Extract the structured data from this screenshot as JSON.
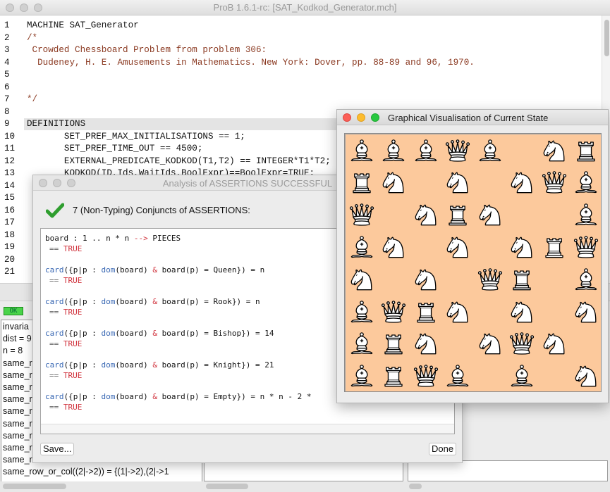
{
  "window": {
    "title": "ProB 1.6.1-rc: [SAT_Kodkod_Generator.mch]"
  },
  "editor": {
    "line_numbers": [
      "1",
      "2",
      "3",
      "4",
      "5",
      "6",
      "7",
      "8",
      "9",
      "10",
      "11",
      "12",
      "13",
      "14",
      "15",
      "16",
      "17",
      "18",
      "19",
      "20",
      "21"
    ],
    "lines": [
      {
        "text": "MACHINE SAT_Generator",
        "style": "code"
      },
      {
        "text": "/*",
        "style": "comment"
      },
      {
        "text": " Crowded Chessboard Problem from problem 306:",
        "style": "comment"
      },
      {
        "text": "  Dudeney, H. E. Amusements in Mathematics. New York: Dover, pp. 88-89 and 96, 1970.",
        "style": "comment"
      },
      {
        "text": "",
        "style": "comment"
      },
      {
        "text": "",
        "style": "comment"
      },
      {
        "text": "*/",
        "style": "comment"
      },
      {
        "text": "",
        "style": "code"
      },
      {
        "text": "DEFINITIONS",
        "style": "code",
        "highlight": true
      },
      {
        "text": "       SET_PREF_MAX_INITIALISATIONS == 1;",
        "style": "code"
      },
      {
        "text": "       SET_PREF_TIME_OUT == 4500;",
        "style": "code"
      },
      {
        "text": "       EXTERNAL_PREDICATE_KODKOD(T1,T2) == INTEGER*T1*T2;",
        "style": "code"
      },
      {
        "text": "       KODKOD(ID,Ids,WaitIds,BoolExpr)==BoolExpr=TRUE;",
        "style": "code"
      }
    ]
  },
  "status": {
    "ok_label": "OK"
  },
  "state_view": {
    "lines": [
      "invaria",
      "dist = 9",
      "n = 8",
      "same_r",
      "same_r",
      "same_r",
      "same_r",
      "same_r",
      "same_r",
      "same_r",
      "same_r",
      "same_r",
      "same_row_or_col((2|->2)) = {(1|->2),(2|->1"
    ]
  },
  "assertions_dialog": {
    "title": "Analysis of ASSERTIONS SUCCESSFUL",
    "summary": "7 (Non-Typing) Conjuncts of ASSERTIONS:",
    "results": [
      {
        "segments": [
          [
            "board : ",
            ""
          ],
          [
            "1 .. n * n ",
            ""
          ],
          [
            "--> ",
            "op"
          ],
          [
            "PIECES",
            ""
          ]
        ],
        "result": "TRUE"
      },
      {
        "segments": [
          [
            "card",
            "kw"
          ],
          [
            "({p|p : ",
            ""
          ],
          [
            "dom",
            "kw"
          ],
          [
            "(board) ",
            ""
          ],
          [
            "& ",
            "op"
          ],
          [
            "board(p) = Queen}) = n",
            ""
          ]
        ],
        "result": "TRUE"
      },
      {
        "segments": [
          [
            "card",
            "kw"
          ],
          [
            "({p|p : ",
            ""
          ],
          [
            "dom",
            "kw"
          ],
          [
            "(board) ",
            ""
          ],
          [
            "& ",
            "op"
          ],
          [
            "board(p) = Rook}) = n",
            ""
          ]
        ],
        "result": "TRUE"
      },
      {
        "segments": [
          [
            "card",
            "kw"
          ],
          [
            "({p|p : ",
            ""
          ],
          [
            "dom",
            "kw"
          ],
          [
            "(board) ",
            ""
          ],
          [
            "& ",
            "op"
          ],
          [
            "board(p) = Bishop}) = 14",
            ""
          ]
        ],
        "result": "TRUE"
      },
      {
        "segments": [
          [
            "card",
            "kw"
          ],
          [
            "({p|p : ",
            ""
          ],
          [
            "dom",
            "kw"
          ],
          [
            "(board) ",
            ""
          ],
          [
            "& ",
            "op"
          ],
          [
            "board(p) = Knight}) = 21",
            ""
          ]
        ],
        "result": "TRUE"
      },
      {
        "segments": [
          [
            "card",
            "kw"
          ],
          [
            "({p|p : ",
            ""
          ],
          [
            "dom",
            "kw"
          ],
          [
            "(board) ",
            ""
          ],
          [
            "& ",
            "op"
          ],
          [
            "board(p) = Empty}) = n * n - 2 *",
            ""
          ]
        ],
        "result": "TRUE"
      }
    ],
    "eq_symbol": "==",
    "save_label": "Save...",
    "done_label": "Done"
  },
  "visualisation": {
    "title": "Graphical Visualisation of Current State",
    "board_bg": "#fcc99c",
    "rows": [
      [
        "B",
        "B",
        "B",
        "Q",
        "B",
        "-",
        "N",
        "R"
      ],
      [
        "R",
        "N",
        "-",
        "N",
        "-",
        "N",
        "Q",
        "B"
      ],
      [
        "Q",
        "-",
        "N",
        "R",
        "N",
        "-",
        "-",
        "B"
      ],
      [
        "B",
        "N",
        "-",
        "N",
        "-",
        "N",
        "R",
        "Q"
      ],
      [
        "N",
        "-",
        "N",
        "-",
        "Q",
        "R",
        "-",
        "B"
      ],
      [
        "B",
        "Q",
        "R",
        "N",
        "-",
        "N",
        "-",
        "N"
      ],
      [
        "B",
        "R",
        "N",
        "-",
        "N",
        "Q",
        "N",
        "-"
      ],
      [
        "B",
        "R",
        "Q",
        "B",
        "-",
        "B",
        "-",
        "N"
      ]
    ]
  }
}
